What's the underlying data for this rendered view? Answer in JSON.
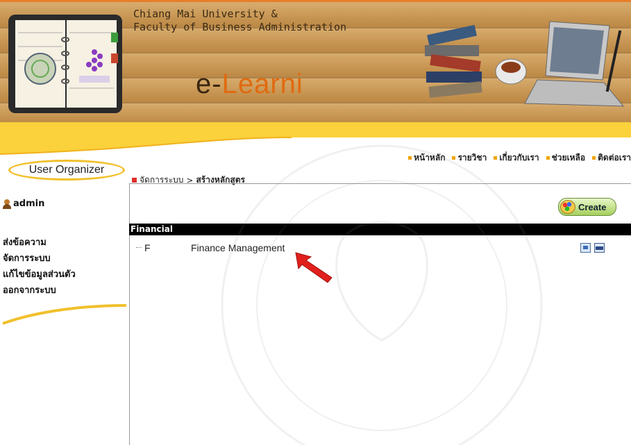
{
  "banner": {
    "title_line1": "Chiang Mai University &",
    "title_line2": "Faculty of Business Administration",
    "logo_text_e": "e-",
    "logo_text_learn": "Learni"
  },
  "nav": {
    "items": [
      {
        "label": "หน้าหลัก"
      },
      {
        "label": "รายวิชา"
      },
      {
        "label": "เกี่ยวกับเรา"
      },
      {
        "label": "ช่วยเหลือ"
      },
      {
        "label": "ติดต่อเรา"
      }
    ]
  },
  "sidebar": {
    "organizer_label": "User Organizer",
    "username": "admin",
    "menu": [
      {
        "label": "ส่งข้อความ"
      },
      {
        "label": "จัดการระบบ"
      },
      {
        "label": "แก้ไขข้อมูลส่วนตัว"
      },
      {
        "label": "ออกจากระบบ"
      }
    ]
  },
  "breadcrumb": {
    "parent": "จัดการระบบ",
    "separator": ">",
    "current": "สร้างหลักสูตร"
  },
  "main": {
    "create_label": "Create",
    "category": "Financial",
    "courses": [
      {
        "code": "F",
        "name": "Finance Management"
      }
    ]
  },
  "colors": {
    "accent_orange": "#e87d2a",
    "nav_bullet": "#f2a500",
    "breadcrumb_square": "#e0302a",
    "category_bar": "#000000",
    "create_button": "#a4cf5c"
  },
  "icons": [
    "open-book-icon",
    "books-stack-icon",
    "laptop-icon",
    "user-icon",
    "palette-icon",
    "edit-icon",
    "folder-icon",
    "red-arrow-icon"
  ]
}
